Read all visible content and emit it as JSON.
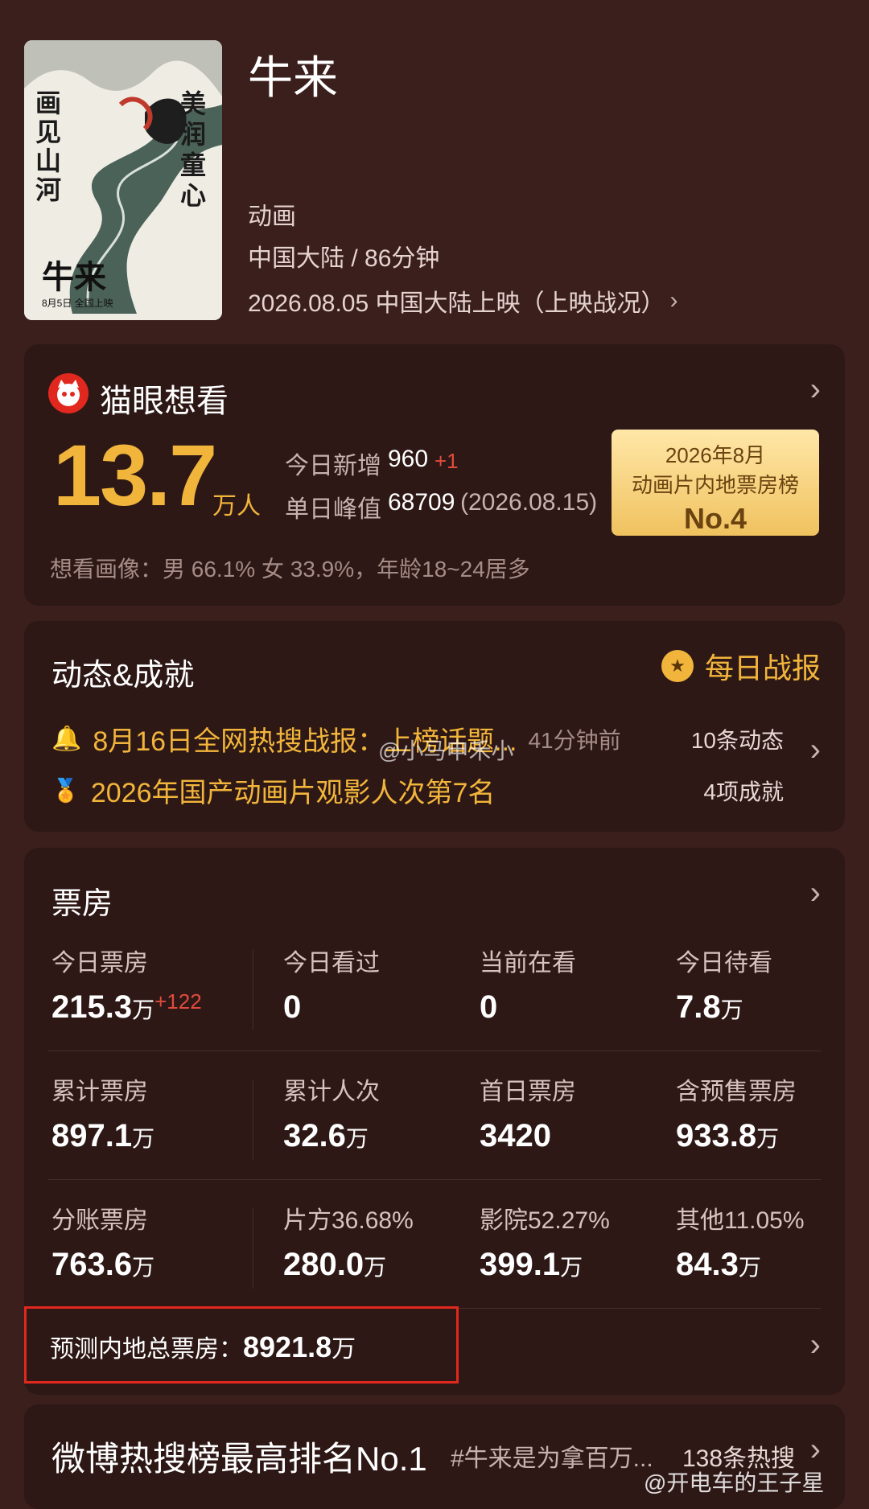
{
  "movie": {
    "title": "牛来",
    "genre": "动画",
    "region_duration": "中国大陆 / 86分钟",
    "release": "2026.08.05 中国大陆上映（上映战况）",
    "poster": {
      "left_text": "画见山河",
      "right_text": "美润童心",
      "logo_text": "牛来",
      "date_text": "8月5日 全国上映"
    }
  },
  "want": {
    "brand": "猫眼想看",
    "count": "13.7",
    "count_unit": "万人",
    "today_label": "今日新增",
    "today_value": "960",
    "today_delta": "+1",
    "peak_label": "单日峰值",
    "peak_value": "68709",
    "peak_date": "(2026.08.15)",
    "badge_line1": "2026年8月",
    "badge_line2": "动画片内地票房榜",
    "badge_rank": "No.4",
    "portrait": "想看画像：男 66.1%  女 33.9%，年龄18~24居多"
  },
  "news": {
    "title": "动态&成就",
    "daily_label": "每日战报",
    "item1": "8月16日全网热搜战报：上榜话题...",
    "item1_time": "41分钟前",
    "item1_count": "10条动态",
    "item2": "2026年国产动画片观影人次第7名",
    "item2_count": "4项成就",
    "watermark": "@小马申禾小"
  },
  "boxoffice": {
    "title": "票房",
    "rows": [
      [
        {
          "label": "今日票房",
          "value": "215.3",
          "unit": "万",
          "delta": "+122"
        },
        {
          "label": "今日看过",
          "value": "0",
          "unit": "",
          "delta": ""
        },
        {
          "label": "当前在看",
          "value": "0",
          "unit": "",
          "delta": ""
        },
        {
          "label": "今日待看",
          "value": "7.8",
          "unit": "万",
          "delta": ""
        }
      ],
      [
        {
          "label": "累计票房",
          "value": "897.1",
          "unit": "万",
          "delta": ""
        },
        {
          "label": "累计人次",
          "value": "32.6",
          "unit": "万",
          "delta": ""
        },
        {
          "label": "首日票房",
          "value": "3420",
          "unit": "",
          "delta": ""
        },
        {
          "label": "含预售票房",
          "value": "933.8",
          "unit": "万",
          "delta": ""
        }
      ],
      [
        {
          "label": "分账票房",
          "value": "763.6",
          "unit": "万",
          "delta": ""
        },
        {
          "label": "片方36.68%",
          "value": "280.0",
          "unit": "万",
          "delta": ""
        },
        {
          "label": "影院52.27%",
          "value": "399.1",
          "unit": "万",
          "delta": ""
        },
        {
          "label": "其他11.05%",
          "value": "84.3",
          "unit": "万",
          "delta": ""
        }
      ]
    ],
    "forecast_label": "预测内地总票房：",
    "forecast_value": "8921.8",
    "forecast_unit": "万"
  },
  "weibo": {
    "title": "微博热搜榜最高排名No.1",
    "tag": "#牛来是为拿百万...",
    "count": "138条热搜",
    "watermark": "@开电车的王子星"
  },
  "colors": {
    "background": "#3a1f1c",
    "card": "#2d1816",
    "accent_gold": "#f2b53b",
    "accent_red": "#e04b3c",
    "highlight_box": "#e0281e"
  }
}
